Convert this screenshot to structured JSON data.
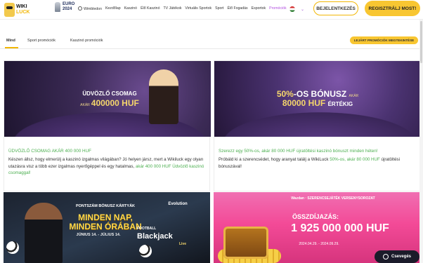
{
  "header": {
    "logo": {
      "line1": "WIKI",
      "line2": "LUCK"
    },
    "euro": {
      "line1": "EURO",
      "line2": "2024"
    },
    "nav": [
      "Wimbledon",
      "Kezdőlap",
      "Kaszinó",
      "Élő Kaszinó",
      "TV Játékok",
      "Virtuális Sportok",
      "Sport",
      "Élő Fogadás",
      "Esportok",
      "Promóciók"
    ],
    "active_nav": "Promóciók",
    "language_flag": "hu-flag",
    "login_label": "BEJELENTKEZÉS",
    "register_label": "REGISZTRÁLJ MOST!"
  },
  "tabs": {
    "items": [
      "Mind",
      "Sport promóciók",
      "Kaszinó promóciók"
    ],
    "active": "Mind",
    "expired_button": "LEJÁRT PROMÓCIÓK MEGTEKINTÉSE"
  },
  "cards": [
    {
      "banner": {
        "line1": "ÜDVÖZLŐ CSOMAG",
        "small": "AKÁR",
        "amount": "400000 HUF"
      },
      "heading": "ÜDVÖZLŐ CSOMAG AKÁR 400 000 HUF",
      "text": "Készen állsz, hogy elmerülj a kaszinó izgalmas világában? Jó helyen jársz, mert a Wikiluck egy olyan utazásra visz a több ezer izgalmas nyerőgéppel és egy hatalmas,",
      "text_green": "akár 400 000 HUF Üdvözlő kaszinó csomaggal!"
    },
    {
      "banner": {
        "line1_gold": "50%",
        "line1_white": "-OS BÓNUSZ",
        "small": "AKÁR",
        "amount": "80000 HUF",
        "suffix": "ÉRTÉKIG"
      },
      "heading": "Szerezz egy 50%-os, akár 80 000 HUF újratöltési kaszinó bónuszt minden héten!",
      "text": "Próbáld ki a szerencsédet, hogy aranyat találj a WikiLuck",
      "text_green": "50%-os, akár 80 000 HUF",
      "text_end": "újratöltési bónuszával!"
    },
    {
      "banner": {
        "top": "PONTSZÁM BÓNUSZ KÁRTYÁK",
        "brand": "Evolution",
        "line1": "MINDEN NAP,",
        "line2": "MINDEN ÓRÁBAN",
        "dates": "JÚNIUS 14. - JÚLIUS 14.",
        "game_top": "FOOTBALL",
        "game": "Blackjack",
        "game_sub": "Live"
      }
    },
    {
      "banner": {
        "brand": "Wazdan · SZERENCSEJÁTÉK VERSENYSOROZAT",
        "label": "ÖSSZDÍJAZÁS:",
        "amount": "1 925 000 000 HUF",
        "dates": "2024.04.29. - 2024.09.29."
      }
    }
  ],
  "chat": {
    "label": "Csevegés"
  }
}
